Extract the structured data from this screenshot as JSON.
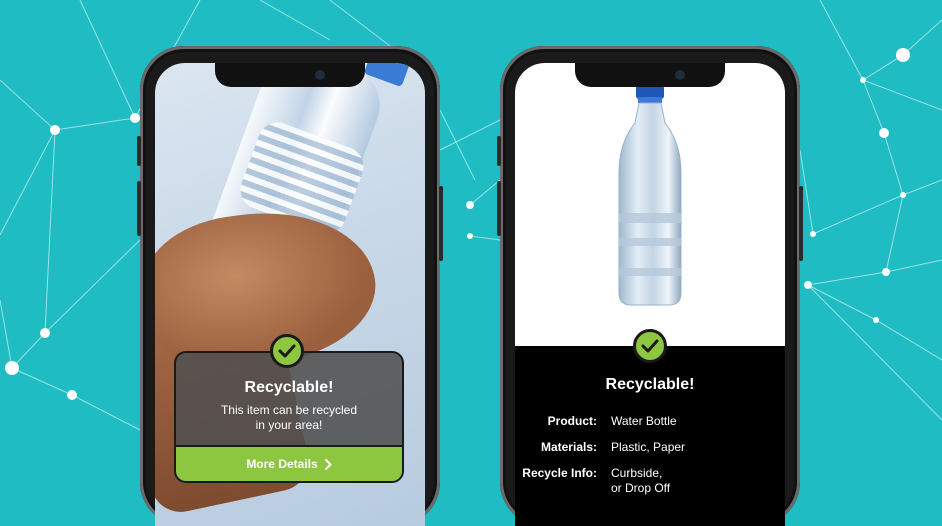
{
  "left_phone": {
    "card": {
      "title": "Recyclable!",
      "message_line1": "This item can be recycled",
      "message_line2": "in your area!",
      "button_label": "More Details"
    }
  },
  "right_phone": {
    "title": "Recyclable!",
    "details": [
      {
        "label": "Product:",
        "value_line1": "Water Bottle",
        "value_line2": ""
      },
      {
        "label": "Materials:",
        "value_line1": "Plastic, Paper",
        "value_line2": ""
      },
      {
        "label": "Recycle Info:",
        "value_line1": "Curbside,",
        "value_line2": "or Drop Off"
      }
    ]
  },
  "colors": {
    "background": "#1fbdc3",
    "accent_green": "#8dc63f",
    "bottle_cap_blue": "#3a7bd5"
  },
  "icons": [
    "checkmark-icon",
    "chevron-right-icon"
  ]
}
